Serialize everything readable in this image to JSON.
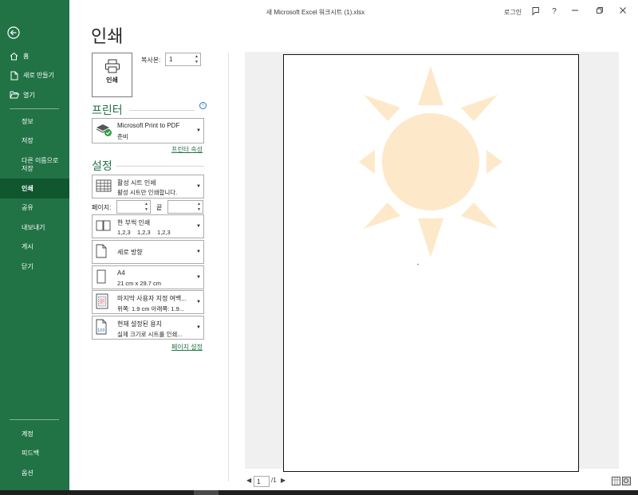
{
  "window": {
    "title": "새 Microsoft Excel 워크시트 (1).xlsx",
    "login": "로그인",
    "help": "?"
  },
  "sidebar": {
    "top_items": [
      {
        "label": "홈",
        "icon": "home-icon"
      },
      {
        "label": "새로 만들기",
        "icon": "new-document-icon"
      },
      {
        "label": "열기",
        "icon": "folder-open-icon"
      }
    ],
    "middle_items": [
      {
        "label": "정보"
      },
      {
        "label": "저장"
      },
      {
        "label": "다른 이름으로 저장",
        "line1": "다른 이름으로",
        "line2": "저장"
      },
      {
        "label": "인쇄",
        "active": true
      },
      {
        "label": "공유"
      },
      {
        "label": "내보내기"
      },
      {
        "label": "게시"
      },
      {
        "label": "닫기"
      }
    ],
    "bottom_items": [
      {
        "label": "계정"
      },
      {
        "label": "피드백"
      },
      {
        "label": "옵션"
      }
    ]
  },
  "print": {
    "page_title": "인쇄",
    "print_button": "인쇄",
    "copies_label": "복사본:",
    "copies_value": "1"
  },
  "printer": {
    "section_title": "프린터",
    "name": "Microsoft Print to PDF",
    "status": "준비",
    "properties_link": "프린터 속성"
  },
  "settings": {
    "section_title": "설정",
    "print_what": {
      "title": "활성 시트 인쇄",
      "desc": "활성 시트만 인쇄합니다."
    },
    "pages_label": "페이지:",
    "to_label": "끝",
    "collate": {
      "title": "한 부씩 인쇄",
      "desc": "1,2,3    1,2,3    1,2,3"
    },
    "orientation": {
      "title": "세로 방향"
    },
    "paper_size": {
      "title": "A4",
      "desc": "21 cm x 29.7 cm"
    },
    "margins": {
      "title": "마지막 사용자 지정 여백...",
      "desc": "위쪽: 1.9 cm 아래쪽: 1.9..."
    },
    "scaling": {
      "title": "현재 설정된 용지",
      "desc": "실제 크기로 시트를 인쇄..."
    },
    "page_setup_link": "페이지 설정"
  },
  "preview": {
    "current_page": "1",
    "total_pages": "/1"
  },
  "colors": {
    "accent": "#217346",
    "sidebar_active": "#10562f",
    "sun": "#fde9c9"
  }
}
